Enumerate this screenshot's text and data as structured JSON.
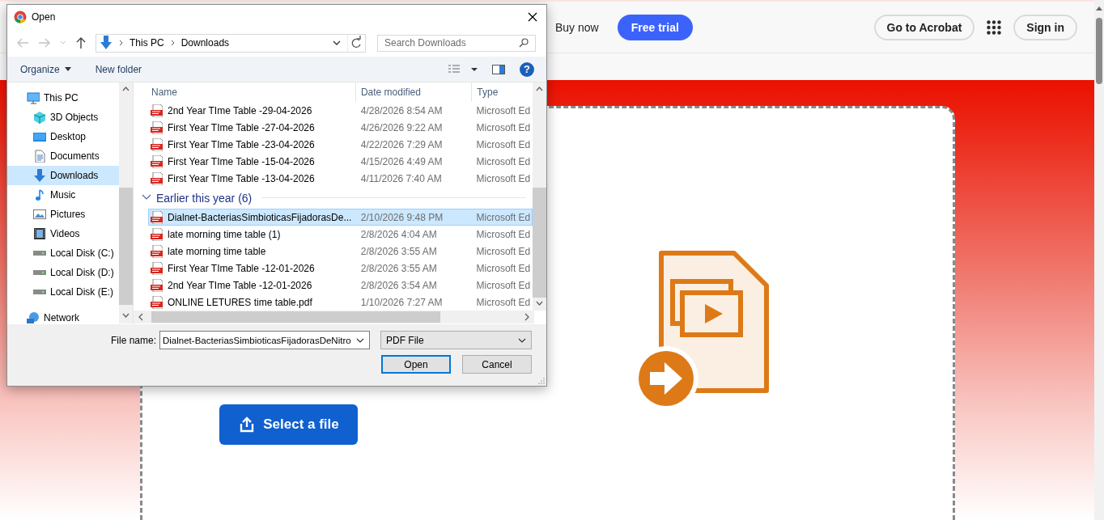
{
  "header": {
    "buy_now": "Buy now",
    "free_trial": "Free trial",
    "go_to_acrobat": "Go to Acrobat",
    "sign_in": "Sign in"
  },
  "upload": {
    "button": "Select a file"
  },
  "dialog": {
    "title": "Open",
    "path": [
      "This PC",
      "Downloads"
    ],
    "search": {
      "placeholder": "Search Downloads"
    },
    "toolbar": {
      "organize": "Organize",
      "new_folder": "New folder",
      "help": "?"
    },
    "sidebar": {
      "items": [
        {
          "label": "This PC",
          "kind": "pc",
          "selected": false,
          "children": [
            {
              "label": "3D Objects",
              "kind": "cube",
              "selected": false
            },
            {
              "label": "Desktop",
              "kind": "desktop",
              "selected": false
            },
            {
              "label": "Documents",
              "kind": "document",
              "selected": false
            },
            {
              "label": "Downloads",
              "kind": "download",
              "selected": true
            },
            {
              "label": "Music",
              "kind": "music",
              "selected": false
            },
            {
              "label": "Pictures",
              "kind": "picture",
              "selected": false
            },
            {
              "label": "Videos",
              "kind": "video",
              "selected": false
            },
            {
              "label": "Local Disk (C:)",
              "kind": "disk",
              "selected": false
            },
            {
              "label": "Local Disk (D:)",
              "kind": "disk",
              "selected": false
            },
            {
              "label": "Local Disk (E:)",
              "kind": "disk",
              "selected": false
            }
          ]
        },
        {
          "label": "Network",
          "kind": "network",
          "selected": false
        }
      ]
    },
    "columns": [
      "Name",
      "Date modified",
      "Type"
    ],
    "groups": [
      {
        "rows": [
          {
            "name": "2nd Year  TIme Table -29-04-2026",
            "date": "4/28/2026 8:54 AM",
            "type": "Microsoft Ed",
            "selected": false
          },
          {
            "name": "First Year  TIme Table -27-04-2026",
            "date": "4/26/2026 9:22 AM",
            "type": "Microsoft Ed",
            "selected": false
          },
          {
            "name": "First Year  TIme Table -23-04-2026",
            "date": "4/22/2026 7:29 AM",
            "type": "Microsoft Ed",
            "selected": false
          },
          {
            "name": "First Year  TIme Table -15-04-2026",
            "date": "4/15/2026 4:49 AM",
            "type": "Microsoft Ed",
            "selected": false
          },
          {
            "name": "First Year  TIme Table -13-04-2026",
            "date": "4/11/2026 7:40 AM",
            "type": "Microsoft Ed",
            "selected": false
          }
        ]
      },
      {
        "label": "Earlier this year (6)",
        "expanded": true,
        "rows": [
          {
            "name": "Dialnet-BacteriasSimbioticasFijadorasDe...",
            "date": "2/10/2026 9:48 PM",
            "type": "Microsoft Ed",
            "selected": true
          },
          {
            "name": "late morning time table (1)",
            "date": "2/8/2026 4:04 AM",
            "type": "Microsoft Ed",
            "selected": false
          },
          {
            "name": "late morning time table",
            "date": "2/8/2026 3:55 AM",
            "type": "Microsoft Ed",
            "selected": false
          },
          {
            "name": "First Year  TIme Table -12-01-2026",
            "date": "2/8/2026 3:55 AM",
            "type": "Microsoft Ed",
            "selected": false
          },
          {
            "name": "2nd Year  TIme Table -12-01-2026",
            "date": "2/8/2026 3:54 AM",
            "type": "Microsoft Ed",
            "selected": false
          },
          {
            "name": "ONLINE LETURES time table.pdf",
            "date": "1/10/2026 7:27 AM",
            "type": "Microsoft Ed",
            "selected": false
          }
        ]
      }
    ],
    "file_name": {
      "label": "File name:",
      "value": "Dialnet-BacteriasSimbioticasFijadorasDeNitro"
    },
    "file_type": "PDF File",
    "buttons": [
      {
        "label": "Open",
        "default": true
      },
      {
        "label": "Cancel",
        "default": false
      }
    ]
  }
}
